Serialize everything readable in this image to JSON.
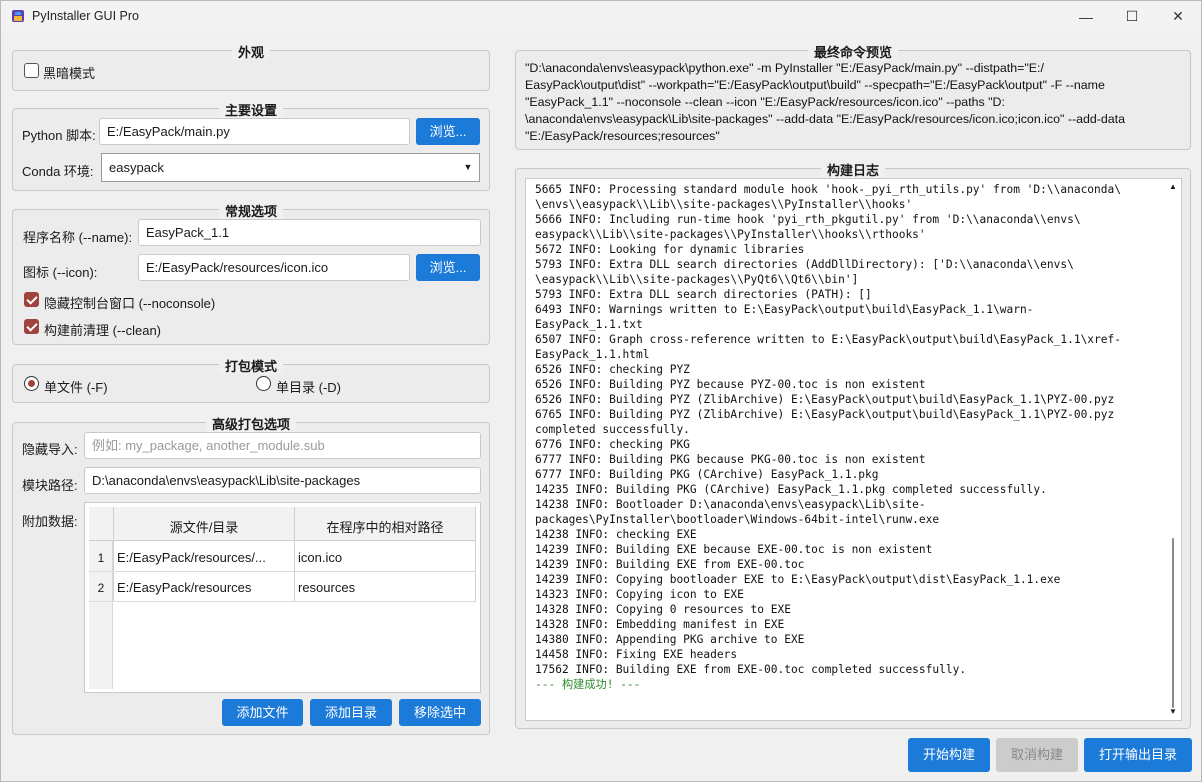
{
  "window": {
    "title": "PyInstaller GUI Pro",
    "minimize_glyph": "—",
    "maximize_glyph": "☐",
    "close_glyph": "✕"
  },
  "appearance": {
    "title": "外观",
    "dark_mode_label": "黑暗模式",
    "dark_mode_checked": false
  },
  "main_settings": {
    "title": "主要设置",
    "script_label": "Python 脚本:",
    "script_value": "E:/EasyPack/main.py",
    "browse_label": "浏览...",
    "conda_label": "Conda 环境:",
    "conda_value": "easypack"
  },
  "general": {
    "title": "常规选项",
    "name_label": "程序名称 (--name):",
    "name_value": "EasyPack_1.1",
    "icon_label": "图标 (--icon):",
    "icon_value": "E:/EasyPack/resources/icon.ico",
    "browse_label": "浏览...",
    "noconsole_label": "隐藏控制台窗口 (--noconsole)",
    "noconsole_checked": true,
    "clean_label": "构建前清理 (--clean)",
    "clean_checked": true
  },
  "pack_mode": {
    "title": "打包模式",
    "onefile_label": "单文件 (-F)",
    "onedir_label": "单目录 (-D)",
    "selected": "onefile"
  },
  "advanced": {
    "title": "高级打包选项",
    "hidden_import_label": "隐藏导入:",
    "hidden_import_placeholder": "例如: my_package, another_module.sub",
    "paths_label": "模块路径:",
    "paths_value": "D:\\anaconda\\envs\\easypack\\Lib\\site-packages",
    "add_data_label": "附加数据:",
    "columns": [
      "源文件/目录",
      "在程序中的相对路径"
    ],
    "rows": [
      {
        "num": "1",
        "src": "E:/EasyPack/resources/...",
        "dest": "icon.ico"
      },
      {
        "num": "2",
        "src": "E:/EasyPack/resources",
        "dest": "resources"
      }
    ],
    "add_file_label": "添加文件",
    "add_dir_label": "添加目录",
    "remove_label": "移除选中"
  },
  "command_preview": {
    "title": "最终命令预览",
    "lines": [
      "\"D:\\anaconda\\envs\\easypack\\python.exe\" -m PyInstaller \"E:/EasyPack/main.py\" --distpath=\"E:/",
      "EasyPack\\output\\dist\" --workpath=\"E:/EasyPack\\output\\build\" --specpath=\"E:/EasyPack\\output\" -F --name",
      "\"EasyPack_1.1\" --noconsole --clean --icon \"E:/EasyPack/resources/icon.ico\" --paths \"D:",
      "\\anaconda\\envs\\easypack\\Lib\\site-packages\" --add-data \"E:/EasyPack/resources/icon.ico;icon.ico\" --add-data",
      "\"E:/EasyPack/resources;resources\""
    ]
  },
  "build_log": {
    "title": "构建日志",
    "lines": [
      "5665 INFO: Processing standard module hook 'hook-_pyi_rth_utils.py' from 'D:\\\\anaconda\\",
      "\\envs\\\\easypack\\\\Lib\\\\site-packages\\\\PyInstaller\\\\hooks'",
      "5666 INFO: Including run-time hook 'pyi_rth_pkgutil.py' from 'D:\\\\anaconda\\\\envs\\",
      "easypack\\\\Lib\\\\site-packages\\\\PyInstaller\\\\hooks\\\\rthooks'",
      "5672 INFO: Looking for dynamic libraries",
      "5793 INFO: Extra DLL search directories (AddDllDirectory): ['D:\\\\anaconda\\\\envs\\",
      "\\easypack\\\\Lib\\\\site-packages\\\\PyQt6\\\\Qt6\\\\bin']",
      "5793 INFO: Extra DLL search directories (PATH): []",
      "6493 INFO: Warnings written to E:\\EasyPack\\output\\build\\EasyPack_1.1\\warn-",
      "EasyPack_1.1.txt",
      "6507 INFO: Graph cross-reference written to E:\\EasyPack\\output\\build\\EasyPack_1.1\\xref-",
      "EasyPack_1.1.html",
      "6526 INFO: checking PYZ",
      "6526 INFO: Building PYZ because PYZ-00.toc is non existent",
      "6526 INFO: Building PYZ (ZlibArchive) E:\\EasyPack\\output\\build\\EasyPack_1.1\\PYZ-00.pyz",
      "6765 INFO: Building PYZ (ZlibArchive) E:\\EasyPack\\output\\build\\EasyPack_1.1\\PYZ-00.pyz",
      "completed successfully.",
      "6776 INFO: checking PKG",
      "6777 INFO: Building PKG because PKG-00.toc is non existent",
      "6777 INFO: Building PKG (CArchive) EasyPack_1.1.pkg",
      "14235 INFO: Building PKG (CArchive) EasyPack_1.1.pkg completed successfully.",
      "14238 INFO: Bootloader D:\\anaconda\\envs\\easypack\\Lib\\site-",
      "packages\\PyInstaller\\bootloader\\Windows-64bit-intel\\runw.exe",
      "14238 INFO: checking EXE",
      "14239 INFO: Building EXE because EXE-00.toc is non existent",
      "14239 INFO: Building EXE from EXE-00.toc",
      "14239 INFO: Copying bootloader EXE to E:\\EasyPack\\output\\dist\\EasyPack_1.1.exe",
      "14323 INFO: Copying icon to EXE",
      "14328 INFO: Copying 0 resources to EXE",
      "14328 INFO: Embedding manifest in EXE",
      "14380 INFO: Appending PKG archive to EXE",
      "14458 INFO: Fixing EXE headers",
      "17562 INFO: Building EXE from EXE-00.toc completed successfully."
    ],
    "success_line": "--- 构建成功! ---"
  },
  "actions": {
    "start_label": "开始构建",
    "cancel_label": "取消构建",
    "open_output_label": "打开输出目录"
  },
  "colors": {
    "accent": "#1c7ad8",
    "checked": "#a0433f",
    "success_text": "#2e8b2e",
    "disabled_btn": "#cccccc"
  }
}
